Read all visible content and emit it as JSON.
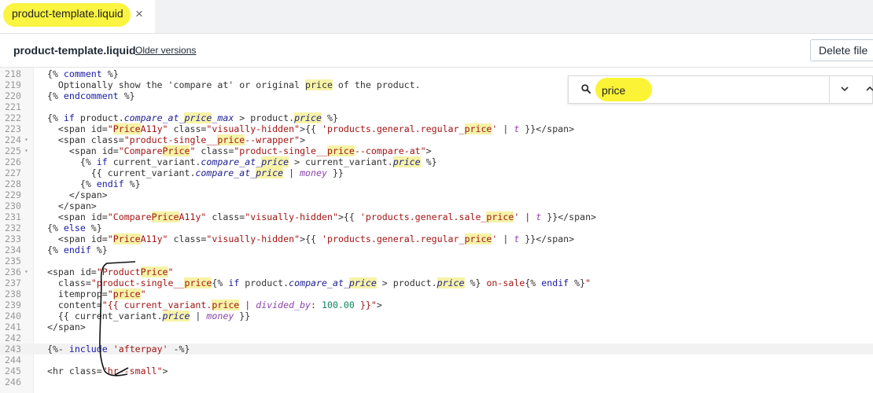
{
  "tab": {
    "label": "product-template.liquid",
    "close": "×"
  },
  "file": {
    "name": "product-template.liquid",
    "older_versions": "Older versions",
    "delete_label": "Delete file"
  },
  "search": {
    "query": "price",
    "placeholder": "Search",
    "icon": "search-icon"
  },
  "lines": [
    {
      "n": "218",
      "fold": false,
      "active": false,
      "tokens": [
        {
          "t": "  {% "
        },
        {
          "t": "comment",
          "c": "kw"
        },
        {
          "t": " %}"
        }
      ]
    },
    {
      "n": "219",
      "fold": false,
      "active": false,
      "tokens": [
        {
          "t": "    Optionally show the 'compare at' or original "
        },
        {
          "t": "price",
          "c": "hl"
        },
        {
          "t": " of the product."
        }
      ]
    },
    {
      "n": "220",
      "fold": false,
      "active": false,
      "tokens": [
        {
          "t": "  {% "
        },
        {
          "t": "endcomment",
          "c": "kw"
        },
        {
          "t": " %}"
        }
      ]
    },
    {
      "n": "221",
      "fold": false,
      "active": false,
      "tokens": [
        {
          "t": ""
        }
      ]
    },
    {
      "n": "222",
      "fold": false,
      "active": false,
      "tokens": [
        {
          "t": "  {% "
        },
        {
          "t": "if",
          "c": "kw"
        },
        {
          "t": " product."
        },
        {
          "t": "compare_at_",
          "c": "var"
        },
        {
          "t": "price",
          "c": "hl var"
        },
        {
          "t": "_max",
          "c": "var"
        },
        {
          "t": " > product."
        },
        {
          "t": "price",
          "c": "hl var"
        },
        {
          "t": " %}"
        }
      ]
    },
    {
      "n": "223",
      "fold": false,
      "active": false,
      "tokens": [
        {
          "t": "    <span id="
        },
        {
          "t": "\"",
          "c": "str"
        },
        {
          "t": "Price",
          "c": "hl str"
        },
        {
          "t": "A11y\"",
          "c": "str"
        },
        {
          "t": " class="
        },
        {
          "t": "\"visually-hidden\"",
          "c": "str"
        },
        {
          "t": ">{{ "
        },
        {
          "t": "'products.general.regular_",
          "c": "str"
        },
        {
          "t": "price",
          "c": "hl str"
        },
        {
          "t": "'",
          "c": "str"
        },
        {
          "t": " | "
        },
        {
          "t": "t",
          "c": "fil"
        },
        {
          "t": " }}</span>"
        }
      ]
    },
    {
      "n": "224",
      "fold": true,
      "active": false,
      "tokens": [
        {
          "t": "    <span class="
        },
        {
          "t": "\"product-single__",
          "c": "str"
        },
        {
          "t": "price",
          "c": "hl str"
        },
        {
          "t": "--wrapper\"",
          "c": "str"
        },
        {
          "t": ">"
        }
      ]
    },
    {
      "n": "225",
      "fold": true,
      "active": false,
      "tokens": [
        {
          "t": "      <span id="
        },
        {
          "t": "\"Compare",
          "c": "str"
        },
        {
          "t": "Price",
          "c": "hl str"
        },
        {
          "t": "\"",
          "c": "str"
        },
        {
          "t": " class="
        },
        {
          "t": "\"product-single__",
          "c": "str"
        },
        {
          "t": "price",
          "c": "hl str"
        },
        {
          "t": "--compare-at\"",
          "c": "str"
        },
        {
          "t": ">"
        }
      ]
    },
    {
      "n": "226",
      "fold": false,
      "active": false,
      "tokens": [
        {
          "t": "        {% "
        },
        {
          "t": "if",
          "c": "kw"
        },
        {
          "t": " current_variant."
        },
        {
          "t": "compare_at_",
          "c": "var"
        },
        {
          "t": "price",
          "c": "hl var"
        },
        {
          "t": " > current_variant."
        },
        {
          "t": "price",
          "c": "hl var"
        },
        {
          "t": " %}"
        }
      ]
    },
    {
      "n": "227",
      "fold": false,
      "active": false,
      "tokens": [
        {
          "t": "          {{ current_variant."
        },
        {
          "t": "compare_at_",
          "c": "var"
        },
        {
          "t": "price",
          "c": "hl var"
        },
        {
          "t": " | "
        },
        {
          "t": "money",
          "c": "fil"
        },
        {
          "t": " }}"
        }
      ]
    },
    {
      "n": "228",
      "fold": false,
      "active": false,
      "tokens": [
        {
          "t": "        {% "
        },
        {
          "t": "endif",
          "c": "kw"
        },
        {
          "t": " %}"
        }
      ]
    },
    {
      "n": "229",
      "fold": false,
      "active": false,
      "tokens": [
        {
          "t": "      </span>"
        }
      ]
    },
    {
      "n": "230",
      "fold": false,
      "active": false,
      "tokens": [
        {
          "t": "    </span>"
        }
      ]
    },
    {
      "n": "231",
      "fold": false,
      "active": false,
      "tokens": [
        {
          "t": "    <span id="
        },
        {
          "t": "\"Compare",
          "c": "str"
        },
        {
          "t": "Price",
          "c": "hl str"
        },
        {
          "t": "A11y\"",
          "c": "str"
        },
        {
          "t": " class="
        },
        {
          "t": "\"visually-hidden\"",
          "c": "str"
        },
        {
          "t": ">{{ "
        },
        {
          "t": "'products.general.sale_",
          "c": "str"
        },
        {
          "t": "price",
          "c": "hl str"
        },
        {
          "t": "'",
          "c": "str"
        },
        {
          "t": " | "
        },
        {
          "t": "t",
          "c": "fil"
        },
        {
          "t": " }}</span>"
        }
      ]
    },
    {
      "n": "232",
      "fold": false,
      "active": false,
      "tokens": [
        {
          "t": "  {% "
        },
        {
          "t": "else",
          "c": "kw"
        },
        {
          "t": " %}"
        }
      ]
    },
    {
      "n": "233",
      "fold": false,
      "active": false,
      "tokens": [
        {
          "t": "    <span id="
        },
        {
          "t": "\"",
          "c": "str"
        },
        {
          "t": "Price",
          "c": "hl str"
        },
        {
          "t": "A11y\"",
          "c": "str"
        },
        {
          "t": " class="
        },
        {
          "t": "\"visually-hidden\"",
          "c": "str"
        },
        {
          "t": ">{{ "
        },
        {
          "t": "'products.general.regular_",
          "c": "str"
        },
        {
          "t": "price",
          "c": "hl str"
        },
        {
          "t": "'",
          "c": "str"
        },
        {
          "t": " | "
        },
        {
          "t": "t",
          "c": "fil"
        },
        {
          "t": " }}</span>"
        }
      ]
    },
    {
      "n": "234",
      "fold": false,
      "active": false,
      "tokens": [
        {
          "t": "  {% "
        },
        {
          "t": "endif",
          "c": "kw"
        },
        {
          "t": " %}"
        }
      ]
    },
    {
      "n": "235",
      "fold": false,
      "active": false,
      "tokens": [
        {
          "t": ""
        }
      ]
    },
    {
      "n": "236",
      "fold": true,
      "active": false,
      "tokens": [
        {
          "t": "  <span id="
        },
        {
          "t": "\"Product",
          "c": "str"
        },
        {
          "t": "Price",
          "c": "hl str"
        },
        {
          "t": "\"",
          "c": "str"
        }
      ]
    },
    {
      "n": "237",
      "fold": false,
      "active": false,
      "tokens": [
        {
          "t": "    class="
        },
        {
          "t": "\"product-single__",
          "c": "str"
        },
        {
          "t": "price",
          "c": "hl str"
        },
        {
          "t": "{% "
        },
        {
          "t": "if",
          "c": "kw"
        },
        {
          "t": " product."
        },
        {
          "t": "compare_at_",
          "c": "var"
        },
        {
          "t": "price",
          "c": "hl var"
        },
        {
          "t": " > product."
        },
        {
          "t": "price",
          "c": "hl var"
        },
        {
          "t": " %}"
        },
        {
          "t": " on-sale",
          "c": "str"
        },
        {
          "t": "{% "
        },
        {
          "t": "endif",
          "c": "kw"
        },
        {
          "t": " %}"
        },
        {
          "t": "\"",
          "c": "str"
        }
      ]
    },
    {
      "n": "238",
      "fold": false,
      "active": false,
      "tokens": [
        {
          "t": "    itemprop="
        },
        {
          "t": "\"",
          "c": "str"
        },
        {
          "t": "price",
          "c": "hl str"
        },
        {
          "t": "\"",
          "c": "str"
        }
      ]
    },
    {
      "n": "239",
      "fold": false,
      "active": false,
      "tokens": [
        {
          "t": "    content="
        },
        {
          "t": "\"{{ current_variant.",
          "c": "str"
        },
        {
          "t": "price",
          "c": "hl str"
        },
        {
          "t": " | ",
          "c": "str"
        },
        {
          "t": "divided_by",
          "c": "fil"
        },
        {
          "t": ": ",
          "c": "str"
        },
        {
          "t": "100.00",
          "c": "num"
        },
        {
          "t": " }}\"",
          "c": "str"
        },
        {
          "t": ">"
        }
      ]
    },
    {
      "n": "240",
      "fold": false,
      "active": false,
      "tokens": [
        {
          "t": "    {{ current_variant."
        },
        {
          "t": "price",
          "c": "hl var"
        },
        {
          "t": " | "
        },
        {
          "t": "money",
          "c": "fil"
        },
        {
          "t": " }}"
        }
      ]
    },
    {
      "n": "241",
      "fold": false,
      "active": false,
      "tokens": [
        {
          "t": "  </span>"
        }
      ]
    },
    {
      "n": "242",
      "fold": false,
      "active": false,
      "tokens": [
        {
          "t": ""
        }
      ]
    },
    {
      "n": "243",
      "fold": false,
      "active": true,
      "tokens": [
        {
          "t": "  {%- "
        },
        {
          "t": "include",
          "c": "kw"
        },
        {
          "t": " "
        },
        {
          "t": "'afterpay'",
          "c": "str"
        },
        {
          "t": " -%}"
        }
      ]
    },
    {
      "n": "244",
      "fold": false,
      "active": false,
      "tokens": [
        {
          "t": ""
        }
      ]
    },
    {
      "n": "245",
      "fold": false,
      "active": false,
      "tokens": [
        {
          "t": "  <hr class="
        },
        {
          "t": "\"hr--small\"",
          "c": "str"
        },
        {
          "t": ">"
        }
      ]
    },
    {
      "n": "246",
      "fold": false,
      "active": false,
      "tokens": [
        {
          "t": ""
        }
      ]
    }
  ]
}
